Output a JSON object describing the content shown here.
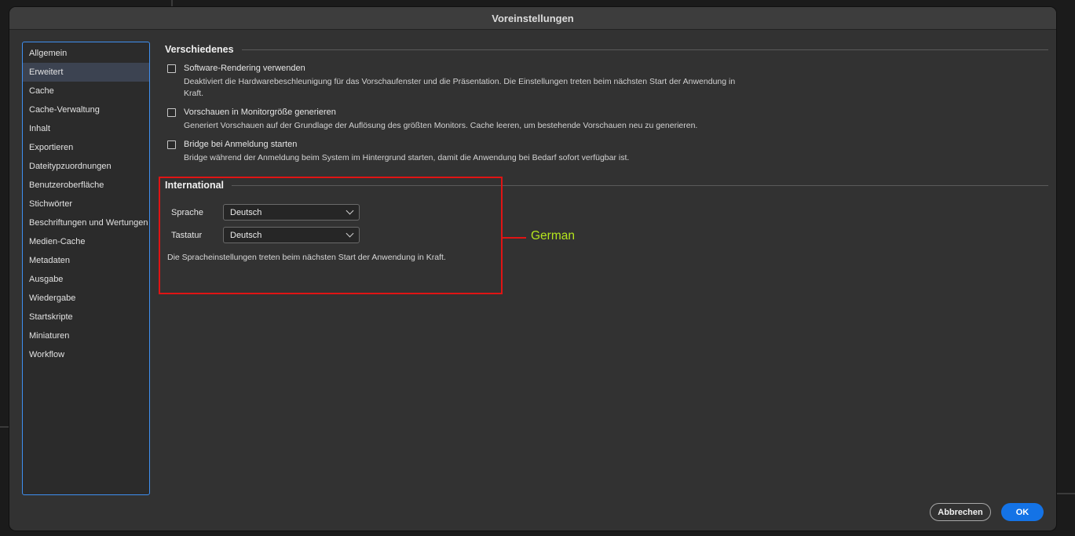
{
  "window": {
    "title": "Voreinstellungen"
  },
  "sidebar": {
    "items": [
      {
        "label": "Allgemein",
        "active": false
      },
      {
        "label": "Erweitert",
        "active": true
      },
      {
        "label": "Cache",
        "active": false
      },
      {
        "label": "Cache-Verwaltung",
        "active": false
      },
      {
        "label": "Inhalt",
        "active": false
      },
      {
        "label": "Exportieren",
        "active": false
      },
      {
        "label": "Dateitypzuordnungen",
        "active": false
      },
      {
        "label": "Benutzeroberfläche",
        "active": false
      },
      {
        "label": "Stichwörter",
        "active": false
      },
      {
        "label": "Beschriftungen und Wertungen",
        "active": false
      },
      {
        "label": "Medien-Cache",
        "active": false
      },
      {
        "label": "Metadaten",
        "active": false
      },
      {
        "label": "Ausgabe",
        "active": false
      },
      {
        "label": "Wiedergabe",
        "active": false
      },
      {
        "label": "Startskripte",
        "active": false
      },
      {
        "label": "Miniaturen",
        "active": false
      },
      {
        "label": "Workflow",
        "active": false
      }
    ]
  },
  "verschiedenes": {
    "title": "Verschiedenes",
    "options": [
      {
        "label": "Software-Rendering verwenden",
        "checked": false,
        "description": "Deaktiviert die Hardwarebeschleunigung für das Vorschaufenster und die Präsentation. Die Einstellungen treten beim nächsten Start der Anwendung in Kraft."
      },
      {
        "label": "Vorschauen in Monitorgröße generieren",
        "checked": false,
        "description": "Generiert Vorschauen auf der Grundlage der Auflösung des größten Monitors.  Cache leeren, um bestehende Vorschauen neu zu generieren."
      },
      {
        "label": "Bridge bei Anmeldung starten",
        "checked": false,
        "description": "Bridge während der Anmeldung beim System im Hintergrund starten, damit die Anwendung bei Bedarf sofort verfügbar ist."
      }
    ]
  },
  "international": {
    "title": "International",
    "sprache": {
      "label": "Sprache",
      "value": "Deutsch"
    },
    "tastatur": {
      "label": "Tastatur",
      "value": "Deutsch"
    },
    "note": "Die Spracheinstellungen treten beim nächsten Start der Anwendung in Kraft."
  },
  "annotation": {
    "text": "German",
    "color": "#b5e61d",
    "box_color": "#e01414"
  },
  "buttons": {
    "cancel": "Abbrechen",
    "ok": "OK"
  },
  "colors": {
    "accent": "#1473e6",
    "sidebar_border": "#3f8ff0"
  }
}
